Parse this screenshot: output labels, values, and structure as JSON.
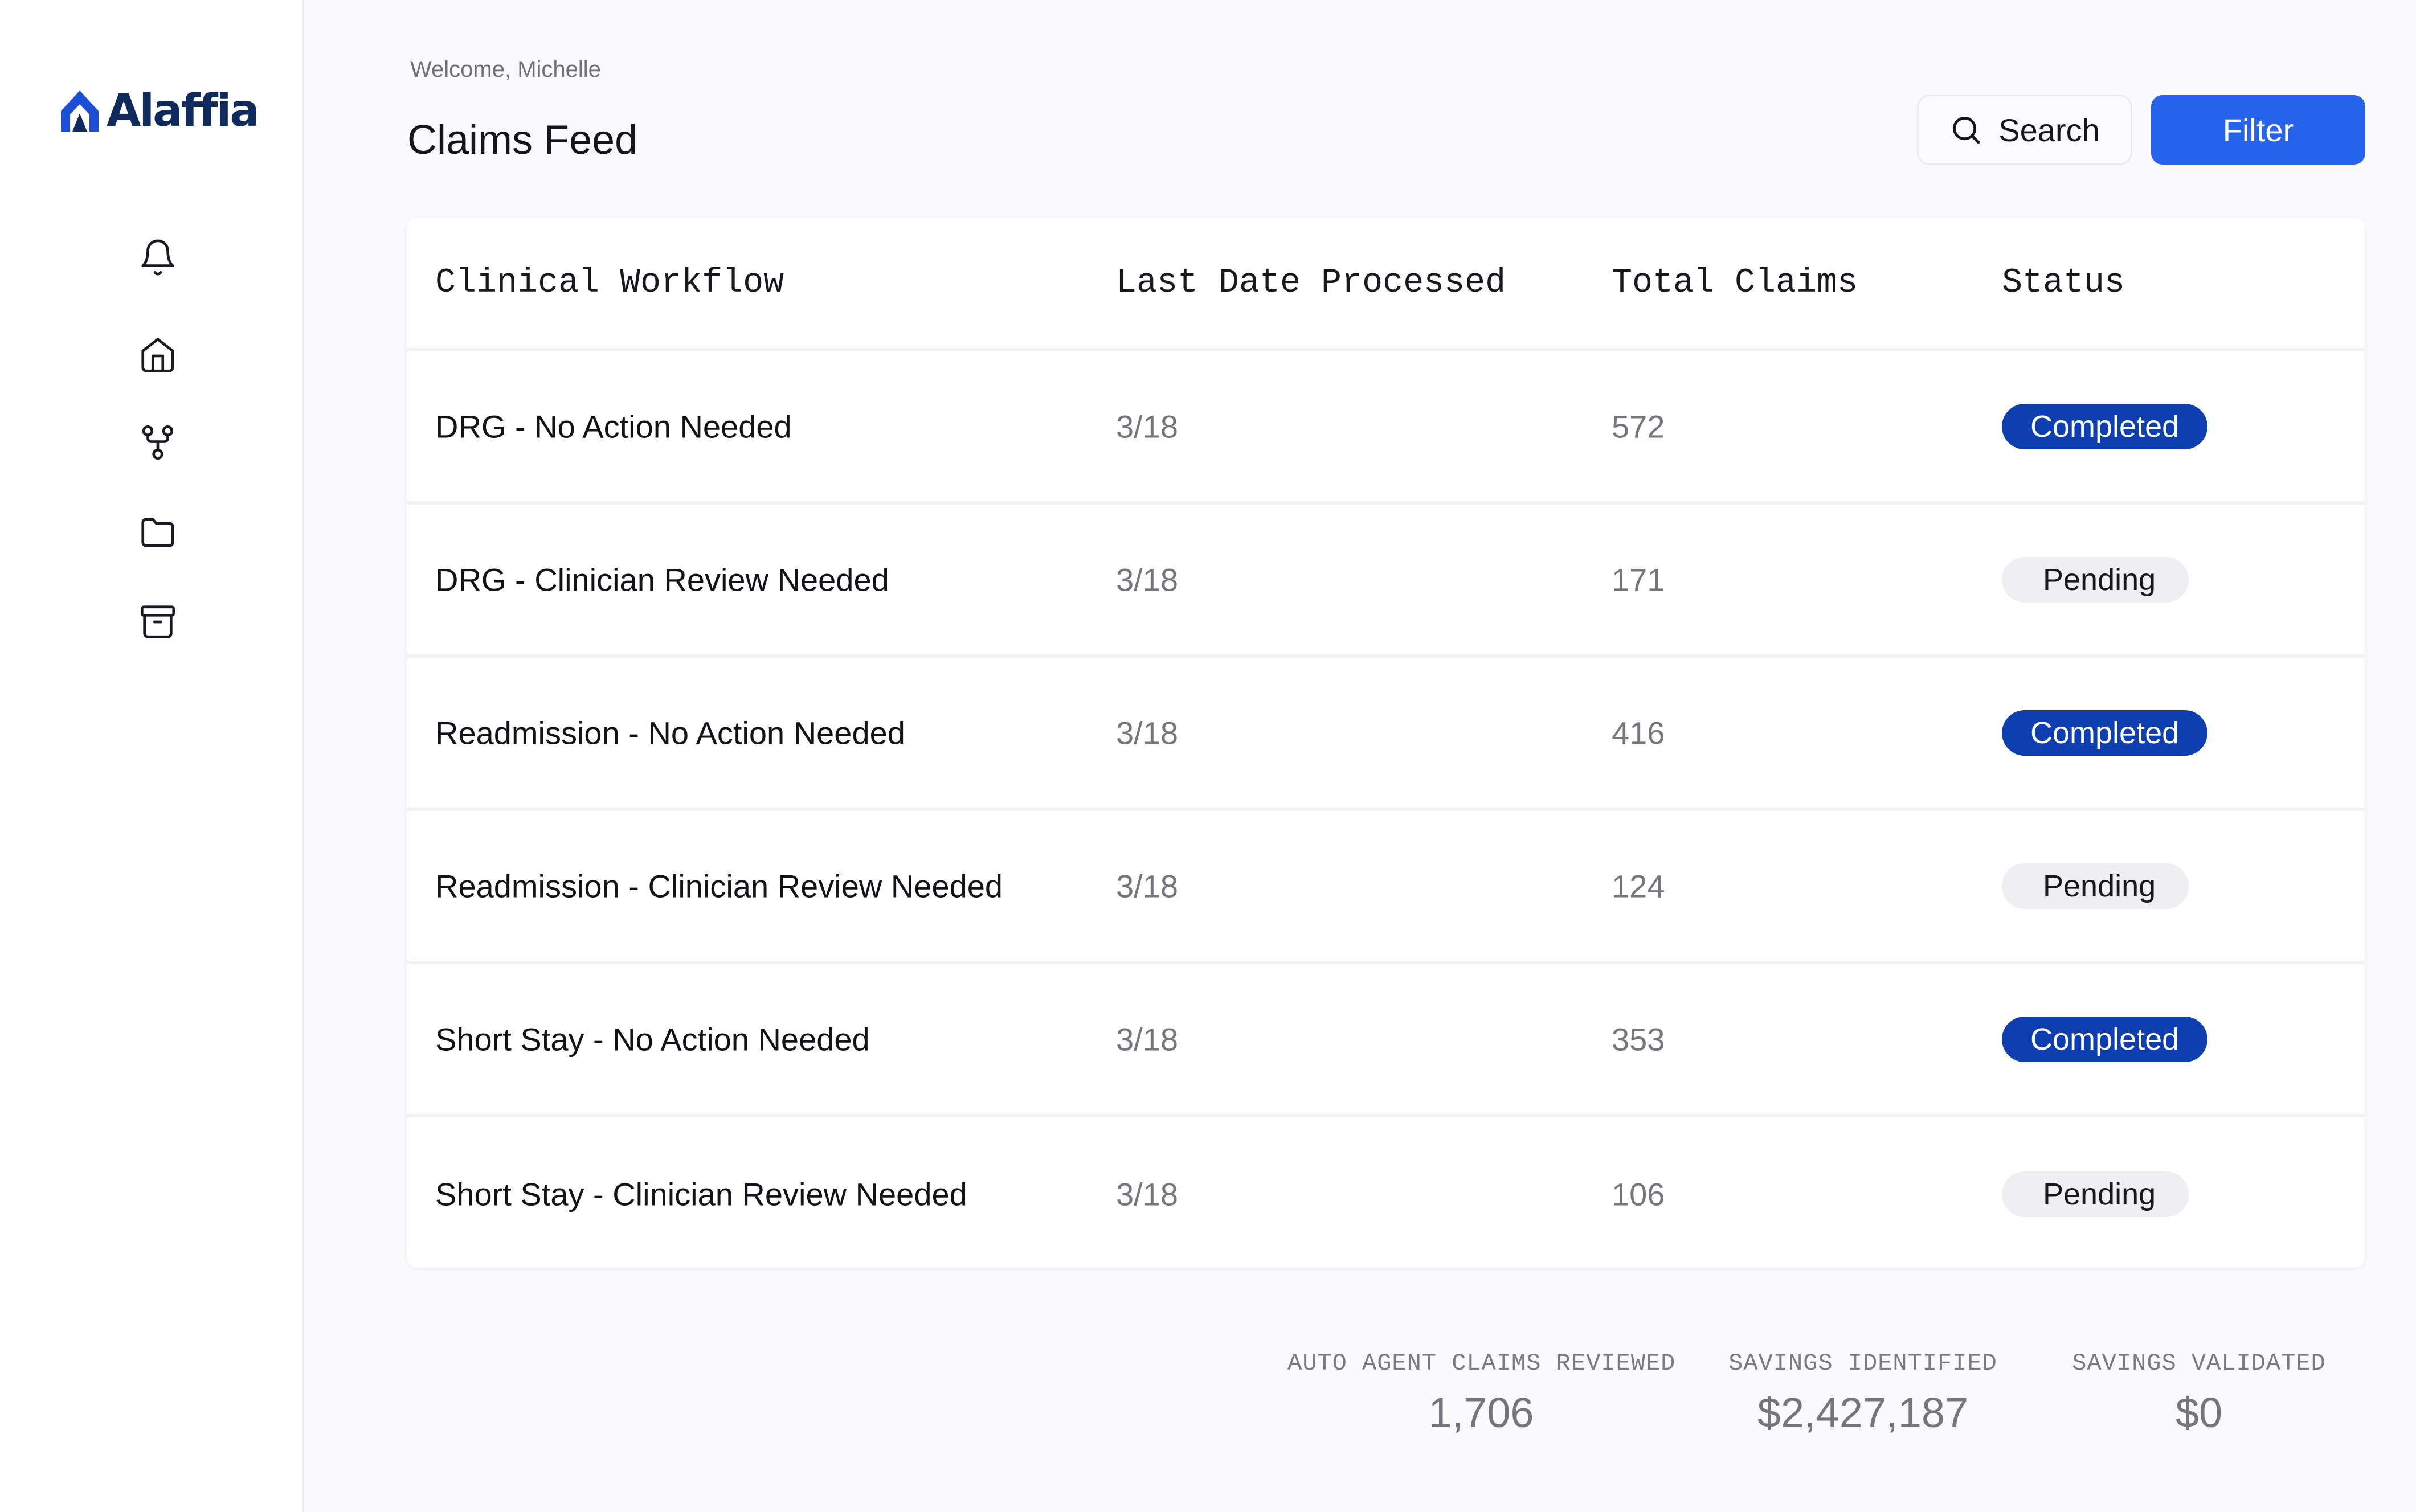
{
  "app": {
    "brand": "Alaffia"
  },
  "header": {
    "welcome": "Welcome, Michelle",
    "title": "Claims Feed",
    "search_label": "Search",
    "filter_label": "Filter"
  },
  "sidebar": {
    "icons": [
      "bell-icon",
      "home-icon",
      "workflow-icon",
      "folder-icon",
      "archive-icon"
    ]
  },
  "table": {
    "columns": [
      "Clinical Workflow",
      "Last Date Processed",
      "Total Claims",
      "Status"
    ],
    "rows": [
      {
        "workflow": "DRG - No Action Needed",
        "date": "3/18",
        "total": "572",
        "status": "Completed"
      },
      {
        "workflow": "DRG - Clinician Review Needed",
        "date": "3/18",
        "total": "171",
        "status": "Pending"
      },
      {
        "workflow": "Readmission - No Action Needed",
        "date": "3/18",
        "total": "416",
        "status": "Completed"
      },
      {
        "workflow": "Readmission - Clinician Review Needed",
        "date": "3/18",
        "total": "124",
        "status": "Pending"
      },
      {
        "workflow": "Short Stay - No Action Needed",
        "date": "3/18",
        "total": "353",
        "status": "Completed"
      },
      {
        "workflow": "Short Stay - Clinician Review Needed",
        "date": "3/18",
        "total": "106",
        "status": "Pending"
      }
    ]
  },
  "stats": [
    {
      "label": "AUTO AGENT CLAIMS REVIEWED",
      "value": "1,706"
    },
    {
      "label": "SAVINGS IDENTIFIED",
      "value": "$2,427,187"
    },
    {
      "label": "SAVINGS VALIDATED",
      "value": "$0"
    }
  ],
  "colors": {
    "accent": "#2563eb",
    "completed_badge": "#0d3fb0",
    "pending_badge": "#efeef2",
    "brand": "#0f2a5c"
  }
}
